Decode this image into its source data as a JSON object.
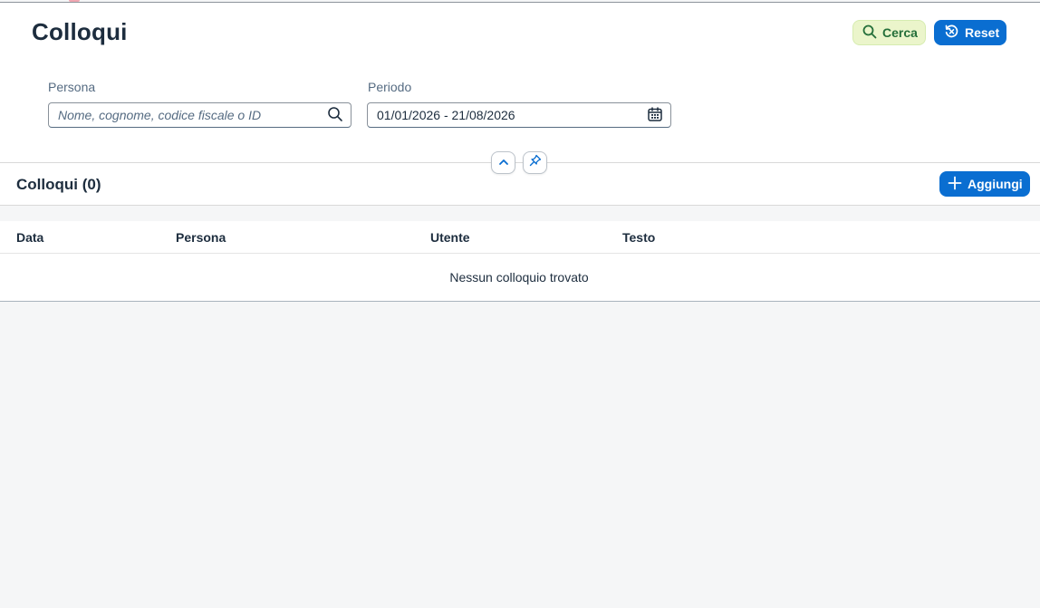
{
  "page": {
    "title": "Colloqui"
  },
  "actions": {
    "search_label": "Cerca",
    "reset_label": "Reset"
  },
  "filters": {
    "persona": {
      "label": "Persona",
      "placeholder": "Nome, cognome, codice fiscale o ID",
      "value": ""
    },
    "periodo": {
      "label": "Periodo",
      "value": "01/01/2026 - 21/08/2026"
    }
  },
  "list": {
    "title": "Colloqui (0)",
    "add_label": "Aggiungi",
    "columns": [
      "Data",
      "Persona",
      "Utente",
      "Testo"
    ],
    "rows": [],
    "empty_message": "Nessun colloquio trovato"
  },
  "colors": {
    "accent": "#0a6ed1",
    "search_button_bg": "#ebf5cb",
    "search_button_text": "#256f3a",
    "page_bg": "#f5f6f7"
  },
  "icons": {
    "search_button": "search-icon",
    "reset_button": "reset-icon",
    "persona_input": "search-icon",
    "periodo_input": "calendar-icon",
    "collapse": "chevron-up-icon",
    "pin": "pin-icon",
    "add": "plus-icon"
  }
}
